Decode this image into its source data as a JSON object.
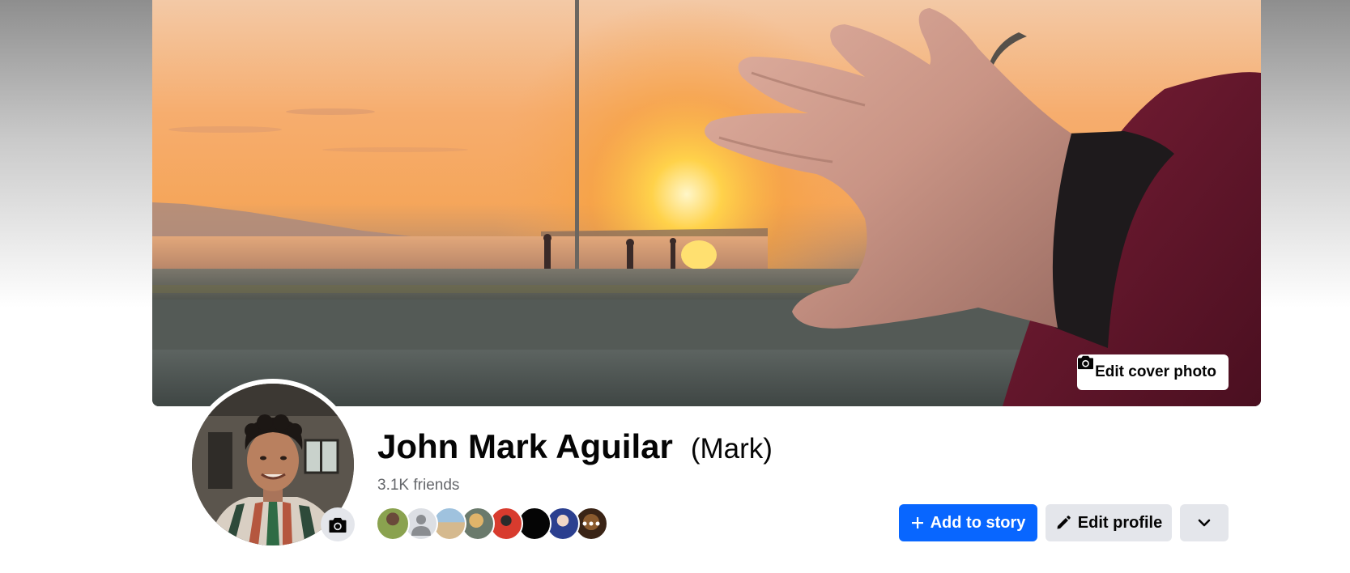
{
  "cover": {
    "edit_button_label": "Edit cover photo",
    "camera_icon": "camera-icon"
  },
  "profile": {
    "name": "John Mark Aguilar",
    "alternate_name": "(Mark)",
    "friends_count_text": "3.1K friends",
    "avatar_camera_icon": "camera-icon"
  },
  "actions": {
    "add_to_story_label": "Add to story",
    "add_icon": "plus-icon",
    "edit_profile_label": "Edit profile",
    "edit_icon": "pencil-icon",
    "more_icon": "chevron-down-icon"
  },
  "friend_avatars_count": 8,
  "colors": {
    "primary_button": "#0866ff",
    "secondary_button": "#e4e6eb",
    "text_primary": "#050505",
    "text_secondary": "#65676b"
  }
}
